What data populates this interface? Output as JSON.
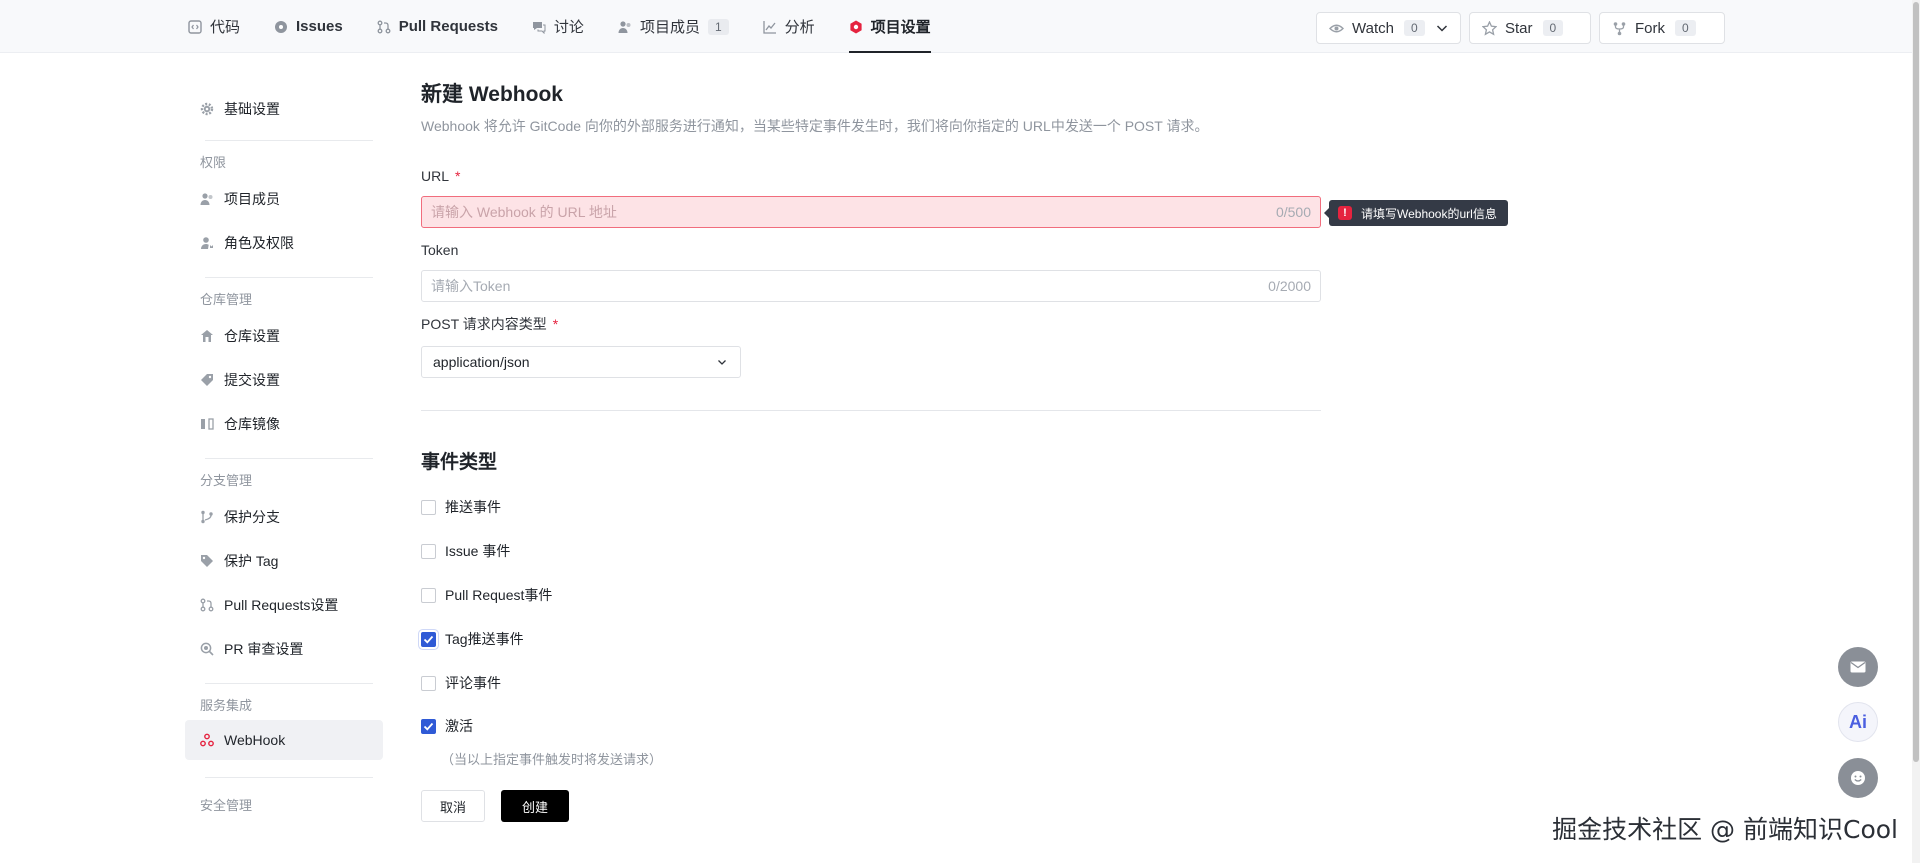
{
  "nav": {
    "tabs": [
      {
        "label": "代码",
        "icon": "code-icon"
      },
      {
        "label": "Issues",
        "icon": "issue-icon"
      },
      {
        "label": "Pull Requests",
        "icon": "pull-request-icon"
      },
      {
        "label": "讨论",
        "icon": "discussion-icon"
      },
      {
        "label": "项目成员",
        "icon": "members-icon",
        "count": "1"
      },
      {
        "label": "分析",
        "icon": "chart-icon"
      },
      {
        "label": "项目设置",
        "icon": "settings-icon",
        "active": true
      }
    ]
  },
  "repo_actions": {
    "watch": {
      "label": "Watch",
      "count": "0"
    },
    "star": {
      "label": "Star",
      "count": "0"
    },
    "fork": {
      "label": "Fork",
      "count": "0"
    }
  },
  "sidebar": {
    "basic": "基础设置",
    "groups": {
      "permissions": "权限",
      "repo": "仓库管理",
      "branch": "分支管理",
      "services": "服务集成",
      "security": "安全管理"
    },
    "items": {
      "members": "项目成员",
      "roles": "角色及权限",
      "repo_settings": "仓库设置",
      "commit_settings": "提交设置",
      "repo_mirror": "仓库镜像",
      "protected_branch": "保护分支",
      "protected_tag": "保护 Tag",
      "pr_settings": "Pull Requests设置",
      "pr_review": "PR 审查设置",
      "webhook": "WebHook"
    }
  },
  "form": {
    "title": "新建 Webhook",
    "description": "Webhook 将允许 GitCode 向你的外部服务进行通知，当某些特定事件发生时，我们将向你指定的 URL中发送一个 POST 请求。",
    "url": {
      "label": "URL",
      "required": "*",
      "placeholder": "请输入 Webhook 的 URL 地址",
      "value": "",
      "count": "0/500",
      "error": "请填写Webhook的url信息"
    },
    "token": {
      "label": "Token",
      "placeholder": "请输入Token",
      "value": "",
      "count": "0/2000"
    },
    "content_type": {
      "label": "POST 请求内容类型",
      "required": "*",
      "value": "application/json"
    },
    "events_title": "事件类型",
    "events": {
      "push": {
        "label": "推送事件",
        "checked": false
      },
      "issue": {
        "label": "Issue 事件",
        "checked": false
      },
      "pr": {
        "label": "Pull Request事件",
        "checked": false
      },
      "tag_push": {
        "label": "Tag推送事件",
        "checked": true
      },
      "comment": {
        "label": "评论事件",
        "checked": false
      },
      "active": {
        "label": "激活",
        "checked": true
      }
    },
    "active_hint": "（当以上指定事件触发时将发送请求）",
    "cancel": "取消",
    "create": "创建"
  },
  "floating": {
    "ai_label": "Ai"
  },
  "watermark": "掘金技术社区 @ 前端知识Cool",
  "colors": {
    "accent": "#e5233f",
    "checkbox": "#2f5ad6",
    "error_bg": "#fde3e6",
    "primary_button": "#000000"
  }
}
